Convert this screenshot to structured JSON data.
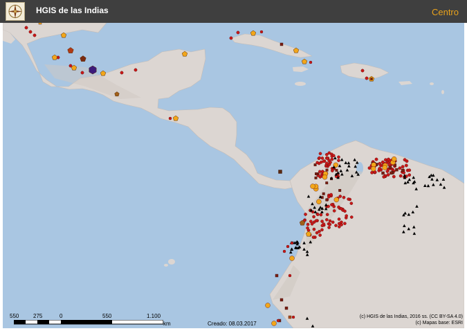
{
  "header": {
    "title": "HGIS de las Indias",
    "region": "Centro",
    "logo_icon": "compass-rose-icon"
  },
  "scale": {
    "labels": [
      "550",
      "275",
      "0",
      "550",
      "1.100"
    ],
    "unit": "km"
  },
  "footer": {
    "created": "Creado: 08.03.2017",
    "credit_line1": "(c) HGIS de las Indias, 2016 ss. (CC BY-SA 4.0)",
    "credit_line2": "(c) Mapas base: ESRI"
  },
  "colors": {
    "header_bg": "#3f3f3f",
    "region_text": "#e9a21c",
    "sea": "#a9c6e2",
    "land": "#dcd6d2",
    "marker_red": "#c81818",
    "marker_orange": "#f2a61a",
    "marker_darkred": "#7a1f13",
    "marker_purple": "#3c1a7a",
    "marker_black": "#000000"
  },
  "legend_markers": [
    "red-circle",
    "orange-pentagon",
    "dark-red-square",
    "purple-hexagon",
    "black-triangle"
  ]
}
